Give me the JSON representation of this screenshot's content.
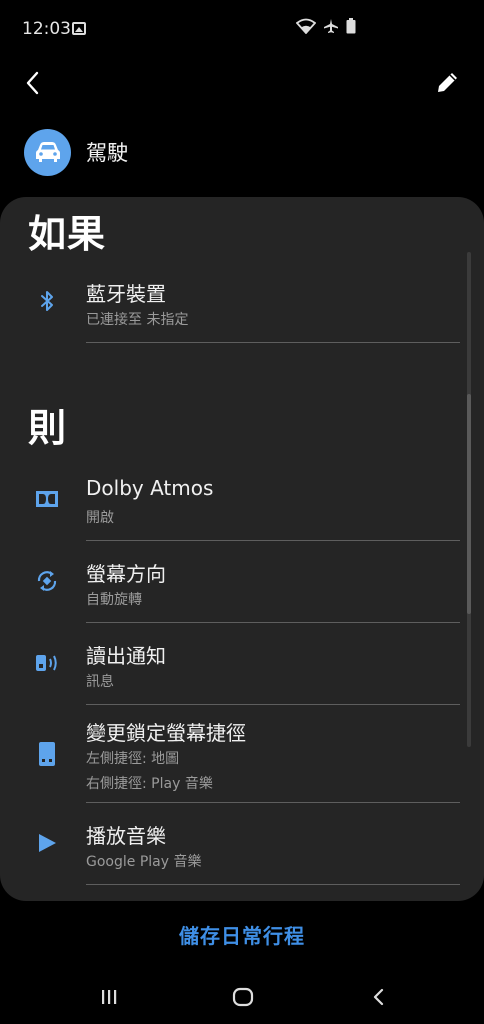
{
  "status_bar": {
    "time": "12:03"
  },
  "top_bar": {},
  "routine": {
    "title": "駕駛"
  },
  "if_section": {
    "heading": "如果",
    "items": [
      {
        "title": "藍牙裝置",
        "subtitle": "已連接至 未指定",
        "icon": "bluetooth-icon"
      }
    ]
  },
  "then_section": {
    "heading": "則",
    "items": [
      {
        "title": "Dolby Atmos",
        "subtitle": "開啟",
        "icon": "dolby-icon"
      },
      {
        "title": "螢幕方向",
        "subtitle": "自動旋轉",
        "icon": "screen-rotation-icon"
      },
      {
        "title": "讀出通知",
        "subtitle": "訊息",
        "icon": "read-aloud-icon"
      },
      {
        "title": "變更鎖定螢幕捷徑",
        "subtitle": "左側捷徑: 地圖",
        "subtitle2": "右側捷徑: Play 音樂",
        "icon": "lock-screen-icon"
      },
      {
        "title": "播放音樂",
        "subtitle": "Google Play 音樂",
        "icon": "play-icon"
      }
    ]
  },
  "footer": {
    "save_label": "儲存日常行程"
  },
  "colors": {
    "accent": "#5ea4ec",
    "card": "#252525",
    "save": "#3f8fe6"
  }
}
